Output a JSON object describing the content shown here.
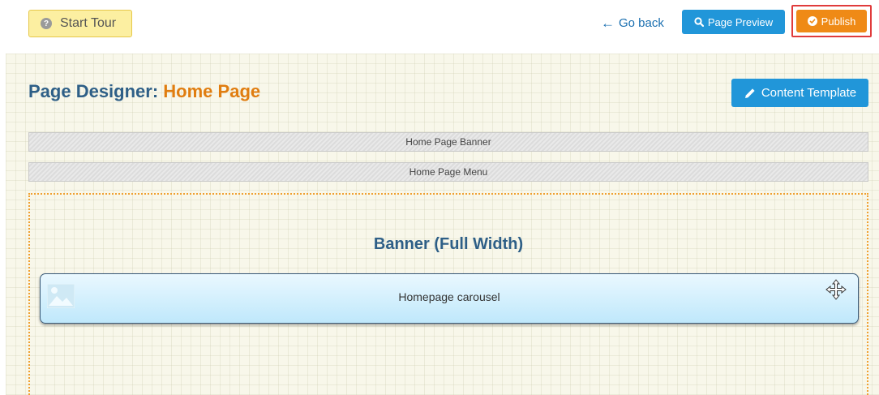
{
  "toolbar": {
    "start_tour_label": "Start Tour",
    "go_back_label": "Go back",
    "page_preview_label": "Page Preview",
    "publish_label": "Publish"
  },
  "page": {
    "title_prefix": "Page Designer:",
    "title_page": "Home Page",
    "content_template_label": "Content Template"
  },
  "regions": [
    {
      "label": "Home Page Banner"
    },
    {
      "label": "Home Page Menu"
    }
  ],
  "zone": {
    "title": "Banner (Full Width)",
    "widget_label": "Homepage carousel"
  },
  "colors": {
    "accent_blue": "#2196d9",
    "publish_orange": "#ef8a16",
    "highlight_red": "#e03b3b",
    "title_blue": "#2e5f87",
    "title_orange": "#e07d10"
  },
  "icons": {
    "tour": "question-circle-icon",
    "back": "arrow-left-icon",
    "preview": "search-icon",
    "publish": "check-circle-icon",
    "template": "pencil-icon",
    "widget": "image-icon",
    "move": "move-arrows-icon"
  }
}
